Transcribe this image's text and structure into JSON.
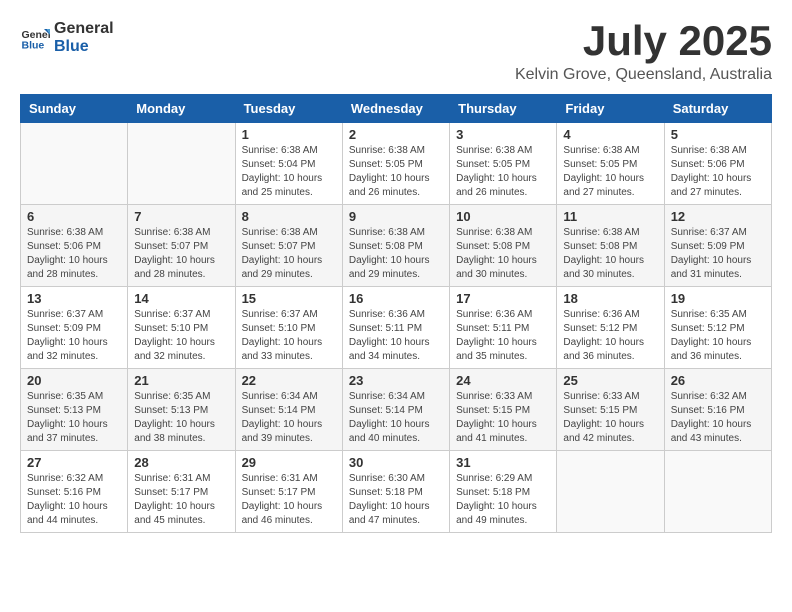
{
  "header": {
    "logo_general": "General",
    "logo_blue": "Blue",
    "title": "July 2025",
    "subtitle": "Kelvin Grove, Queensland, Australia"
  },
  "calendar": {
    "days_of_week": [
      "Sunday",
      "Monday",
      "Tuesday",
      "Wednesday",
      "Thursday",
      "Friday",
      "Saturday"
    ],
    "weeks": [
      [
        {
          "day": "",
          "info": ""
        },
        {
          "day": "",
          "info": ""
        },
        {
          "day": "1",
          "info": "Sunrise: 6:38 AM\nSunset: 5:04 PM\nDaylight: 10 hours and 25 minutes."
        },
        {
          "day": "2",
          "info": "Sunrise: 6:38 AM\nSunset: 5:05 PM\nDaylight: 10 hours and 26 minutes."
        },
        {
          "day": "3",
          "info": "Sunrise: 6:38 AM\nSunset: 5:05 PM\nDaylight: 10 hours and 26 minutes."
        },
        {
          "day": "4",
          "info": "Sunrise: 6:38 AM\nSunset: 5:05 PM\nDaylight: 10 hours and 27 minutes."
        },
        {
          "day": "5",
          "info": "Sunrise: 6:38 AM\nSunset: 5:06 PM\nDaylight: 10 hours and 27 minutes."
        }
      ],
      [
        {
          "day": "6",
          "info": "Sunrise: 6:38 AM\nSunset: 5:06 PM\nDaylight: 10 hours and 28 minutes."
        },
        {
          "day": "7",
          "info": "Sunrise: 6:38 AM\nSunset: 5:07 PM\nDaylight: 10 hours and 28 minutes."
        },
        {
          "day": "8",
          "info": "Sunrise: 6:38 AM\nSunset: 5:07 PM\nDaylight: 10 hours and 29 minutes."
        },
        {
          "day": "9",
          "info": "Sunrise: 6:38 AM\nSunset: 5:08 PM\nDaylight: 10 hours and 29 minutes."
        },
        {
          "day": "10",
          "info": "Sunrise: 6:38 AM\nSunset: 5:08 PM\nDaylight: 10 hours and 30 minutes."
        },
        {
          "day": "11",
          "info": "Sunrise: 6:38 AM\nSunset: 5:08 PM\nDaylight: 10 hours and 30 minutes."
        },
        {
          "day": "12",
          "info": "Sunrise: 6:37 AM\nSunset: 5:09 PM\nDaylight: 10 hours and 31 minutes."
        }
      ],
      [
        {
          "day": "13",
          "info": "Sunrise: 6:37 AM\nSunset: 5:09 PM\nDaylight: 10 hours and 32 minutes."
        },
        {
          "day": "14",
          "info": "Sunrise: 6:37 AM\nSunset: 5:10 PM\nDaylight: 10 hours and 32 minutes."
        },
        {
          "day": "15",
          "info": "Sunrise: 6:37 AM\nSunset: 5:10 PM\nDaylight: 10 hours and 33 minutes."
        },
        {
          "day": "16",
          "info": "Sunrise: 6:36 AM\nSunset: 5:11 PM\nDaylight: 10 hours and 34 minutes."
        },
        {
          "day": "17",
          "info": "Sunrise: 6:36 AM\nSunset: 5:11 PM\nDaylight: 10 hours and 35 minutes."
        },
        {
          "day": "18",
          "info": "Sunrise: 6:36 AM\nSunset: 5:12 PM\nDaylight: 10 hours and 36 minutes."
        },
        {
          "day": "19",
          "info": "Sunrise: 6:35 AM\nSunset: 5:12 PM\nDaylight: 10 hours and 36 minutes."
        }
      ],
      [
        {
          "day": "20",
          "info": "Sunrise: 6:35 AM\nSunset: 5:13 PM\nDaylight: 10 hours and 37 minutes."
        },
        {
          "day": "21",
          "info": "Sunrise: 6:35 AM\nSunset: 5:13 PM\nDaylight: 10 hours and 38 minutes."
        },
        {
          "day": "22",
          "info": "Sunrise: 6:34 AM\nSunset: 5:14 PM\nDaylight: 10 hours and 39 minutes."
        },
        {
          "day": "23",
          "info": "Sunrise: 6:34 AM\nSunset: 5:14 PM\nDaylight: 10 hours and 40 minutes."
        },
        {
          "day": "24",
          "info": "Sunrise: 6:33 AM\nSunset: 5:15 PM\nDaylight: 10 hours and 41 minutes."
        },
        {
          "day": "25",
          "info": "Sunrise: 6:33 AM\nSunset: 5:15 PM\nDaylight: 10 hours and 42 minutes."
        },
        {
          "day": "26",
          "info": "Sunrise: 6:32 AM\nSunset: 5:16 PM\nDaylight: 10 hours and 43 minutes."
        }
      ],
      [
        {
          "day": "27",
          "info": "Sunrise: 6:32 AM\nSunset: 5:16 PM\nDaylight: 10 hours and 44 minutes."
        },
        {
          "day": "28",
          "info": "Sunrise: 6:31 AM\nSunset: 5:17 PM\nDaylight: 10 hours and 45 minutes."
        },
        {
          "day": "29",
          "info": "Sunrise: 6:31 AM\nSunset: 5:17 PM\nDaylight: 10 hours and 46 minutes."
        },
        {
          "day": "30",
          "info": "Sunrise: 6:30 AM\nSunset: 5:18 PM\nDaylight: 10 hours and 47 minutes."
        },
        {
          "day": "31",
          "info": "Sunrise: 6:29 AM\nSunset: 5:18 PM\nDaylight: 10 hours and 49 minutes."
        },
        {
          "day": "",
          "info": ""
        },
        {
          "day": "",
          "info": ""
        }
      ]
    ]
  }
}
